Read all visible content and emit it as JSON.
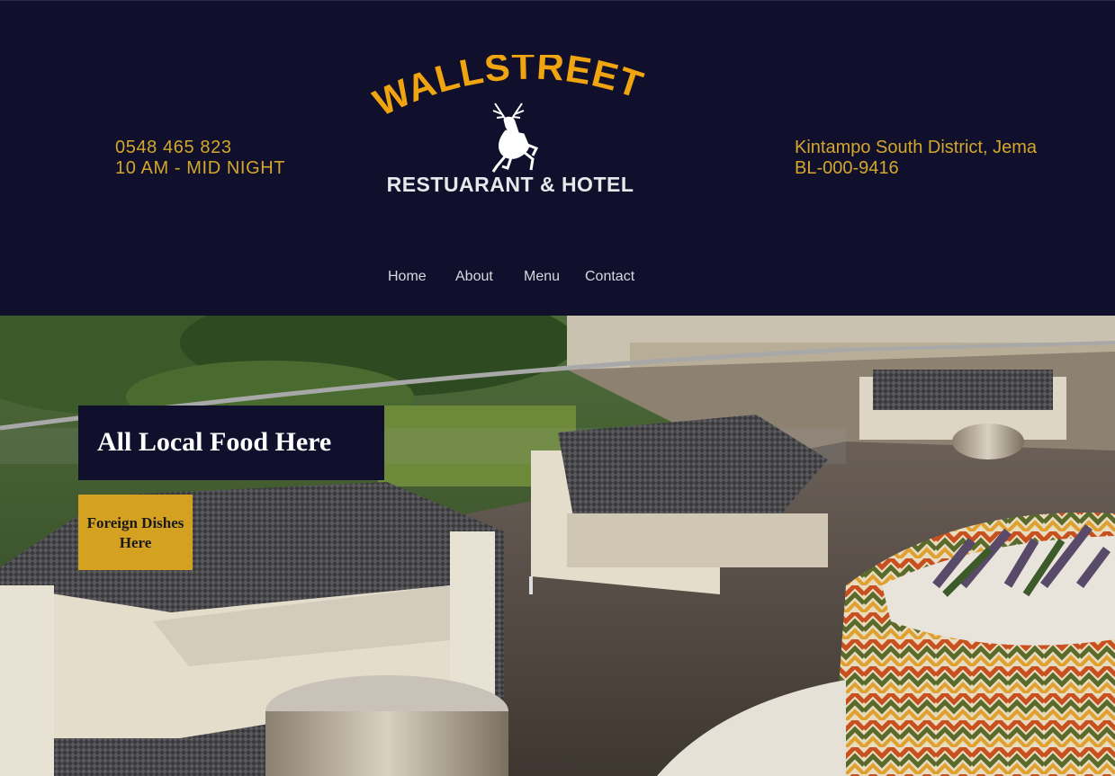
{
  "header": {
    "phone": "0548 465 823",
    "hours": "10 AM - MID NIGHT",
    "address_line1": "Kintampo South District, Jema",
    "address_line2": "BL-000-9416",
    "logo": {
      "top_text": "WALLSTREET",
      "bottom_text": "RESTUARANT & HOTEL",
      "icon": "deer-icon"
    }
  },
  "nav": {
    "items": [
      {
        "label": "Home"
      },
      {
        "label": "About"
      },
      {
        "label": "Menu"
      },
      {
        "label": "Contact"
      }
    ]
  },
  "hero": {
    "image": "terrace-lounge-photo",
    "headline": "All Local Food Here",
    "subline": "Foreign Dishes Here"
  },
  "colors": {
    "navy": "#10102c",
    "gold": "#d4a72c",
    "button_gold": "#d4a120",
    "nav_text": "#d8d8de"
  }
}
